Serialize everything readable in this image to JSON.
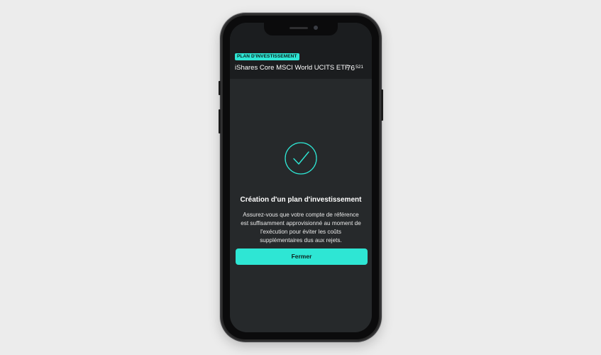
{
  "header": {
    "badge": "PLAN D'INVESTISSEMENT",
    "asset_name": "iShares Core MSCI World UCITS ETF",
    "price_main": "76",
    "price_decimals": "521"
  },
  "confirmation": {
    "icon": "checkmark-circle-icon",
    "title": "Création d'un plan d'investissement",
    "description": "Assurez-vous que votre compte de référence est suffisamment approvisionné au moment de l'exécution pour éviter les coûts supplémentaires dus aux rejets.",
    "close_label": "Fermer"
  },
  "colors": {
    "accent": "#2ee6d4",
    "background": "#26292b",
    "header_background": "#1b1d1f"
  }
}
